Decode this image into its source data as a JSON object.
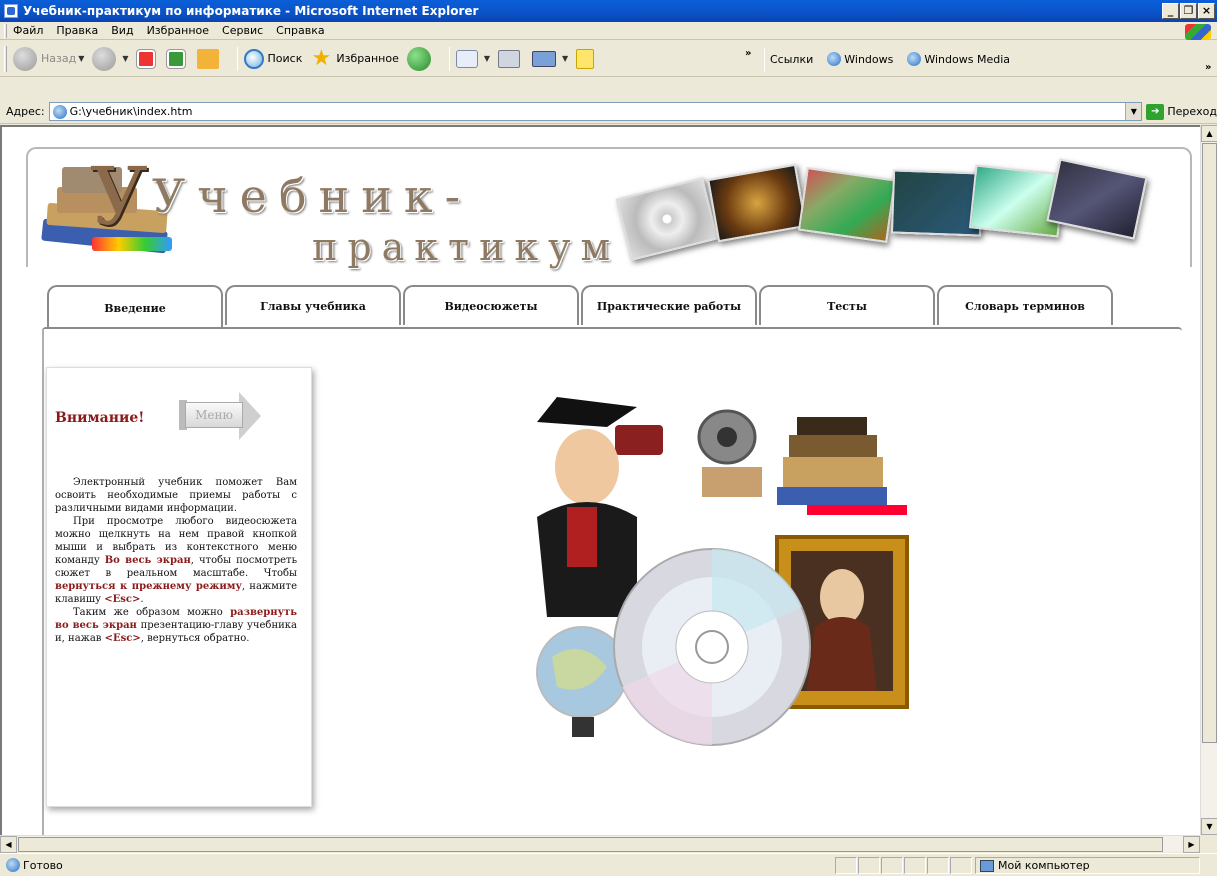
{
  "window": {
    "title": "Учебник-практикум по информатике - Microsoft Internet Explorer",
    "controls": [
      "_",
      "❐",
      "×"
    ]
  },
  "menu": [
    "Файл",
    "Правка",
    "Вид",
    "Избранное",
    "Сервис",
    "Справка"
  ],
  "toolbar": {
    "back_label": "Назад",
    "search_label": "Поиск",
    "favorites_label": "Избранное"
  },
  "links": {
    "label": "Ссылки",
    "items": [
      "Windows",
      "Windows Media"
    ]
  },
  "address": {
    "label": "Адрес:",
    "value": "G:\\учебник\\index.htm",
    "go_label": "Переход"
  },
  "page": {
    "title_line1": "Учебник-",
    "title_line2": "практикум",
    "tabs": [
      "Введение",
      "Главы учебника",
      "Видеосюжеты",
      "Практические работы",
      "Тесты",
      "Словарь терминов"
    ],
    "active_tab": "Введение",
    "side": {
      "attention": "Внимание!",
      "menu_button": "Меню",
      "p1": "Электронный учебник поможет Вам освоить необходимые приемы работы с различными видами информации.",
      "p2_a": "При просмотре любого видеосюжета можно щелкнуть на нем правой кнопкой мыши и выбрать из контекстного меню команду ",
      "p2_b1": "Во весь экран",
      "p2_c": ", чтобы посмотреть сюжет в реальном масштабе. Чтобы ",
      "p2_b2": "вернуться к прежнему режиму",
      "p2_d": ", нажмите клавишу ",
      "p2_key": "<Esc>",
      "p2_e": ".",
      "p3_a": "Таким же образом можно ",
      "p3_b": "развернуть во весь экран",
      "p3_c": " презентацию-главу учебника и, нажав ",
      "p3_key": "<Esc>",
      "p3_d": ", вернуться обратно."
    }
  },
  "status": {
    "text": "Готово",
    "zone": "Мой компьютер"
  }
}
